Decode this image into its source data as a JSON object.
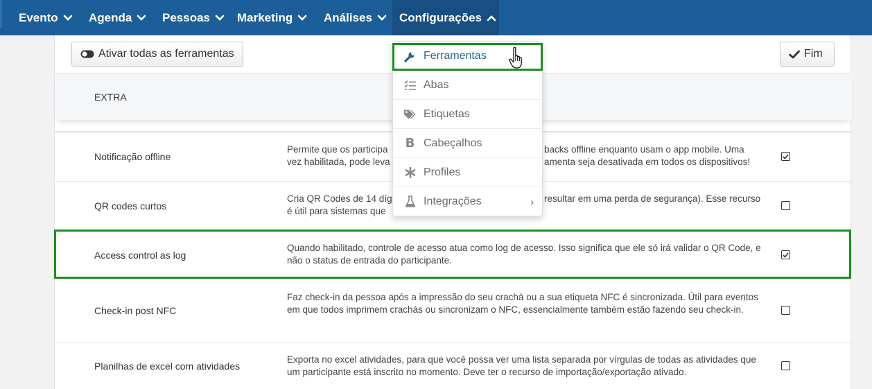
{
  "nav": {
    "items": [
      {
        "label": "Evento"
      },
      {
        "label": "Agenda"
      },
      {
        "label": "Pessoas"
      },
      {
        "label": "Marketing"
      },
      {
        "label": "Análises"
      },
      {
        "label": "Configurações"
      }
    ],
    "active_index": 5
  },
  "toolbar": {
    "activate_all_label": "Ativar todas as ferramentas",
    "done_label": "Fim"
  },
  "section": {
    "title": "EXTRA"
  },
  "dropdown": {
    "items": [
      {
        "label": "Ferramentas",
        "icon": "wrench-icon",
        "active": true
      },
      {
        "label": "Abas",
        "icon": "list-check-icon"
      },
      {
        "label": "Etiquetas",
        "icon": "tags-icon"
      },
      {
        "label": "Cabeçalhos",
        "icon": "bold-icon"
      },
      {
        "label": "Profiles",
        "icon": "asterisk-icon"
      },
      {
        "label": "Integrações",
        "icon": "flask-icon",
        "has_submenu": true
      }
    ],
    "submenu_glyph": "›"
  },
  "rows": [
    {
      "name": "Notificação offline",
      "desc": "Permite que os participa… backs offline enquanto usam o app mobile. Uma vez habilitada, pode leva… amenta seja desativada em todos os dispositivos!",
      "desc1": "Permite que os participa",
      "desc1b": "backs offline enquanto usam o app mobile. Uma",
      "desc2": "vez habilitada, pode leva",
      "desc2b": "amenta seja desativada em todos os dispositivos!",
      "checked": true
    },
    {
      "name": "QR codes curtos",
      "desc1": "Cria QR Codes de 14 díg",
      "desc1b": "resultar em uma perda de segurança). Esse recurso",
      "desc2": "é útil para sistemas que",
      "desc2b": "",
      "checked": false
    },
    {
      "name": "Access control as log",
      "desc": "Quando habilitado, controle de acesso atua como log de acesso. Isso significa que ele só irá validar o QR Code, e não o status de entrada do participante.",
      "checked": true
    },
    {
      "name": "Check-in post NFC",
      "desc": "Faz check-in da pessoa após a impressão do seu crachá ou a sua etiqueta NFC é sincronizada. Útil para eventos em que todos imprimem crachás ou sincronizam o NFC, essencialmente também estão fazendo seu check-in.",
      "checked": false
    },
    {
      "name": "Planilhas de excel com atividades",
      "desc": "Exporta no excel atividades, para que você possa ver uma lista separada por vírgulas de todas as atividades que um participante está inscrito no momento. Deve ter o recurso de importação/exportação ativado.",
      "checked": false
    }
  ],
  "colors": {
    "nav_bg": "#1b5e9a",
    "nav_active_bg": "#174f83",
    "highlight": "#1e8e1e",
    "dropdown_active": "#2b5f8f"
  }
}
